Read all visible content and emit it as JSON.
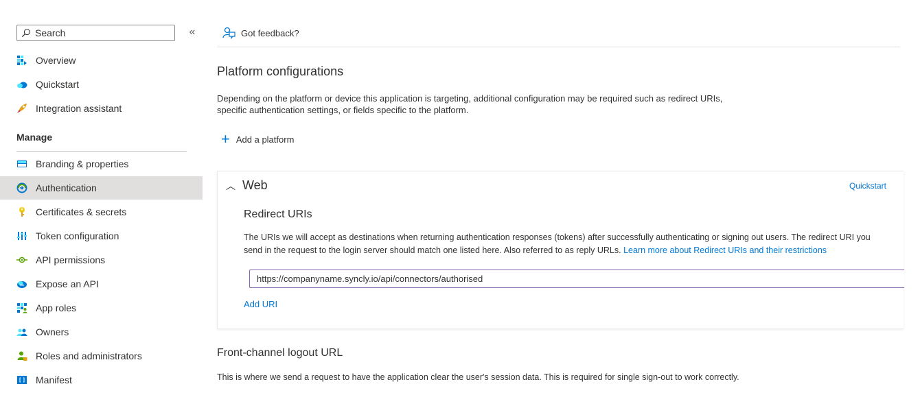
{
  "sidebar": {
    "search": {
      "placeholder": "Search",
      "value": ""
    },
    "collapse_glyph": "«",
    "section_label": "Manage",
    "items": [
      {
        "label": "Overview",
        "icon": "overview-icon",
        "color": "#0078d4"
      },
      {
        "label": "Quickstart",
        "icon": "quickstart-icon",
        "color": "#0078d4"
      },
      {
        "label": "Integration assistant",
        "icon": "rocket-icon",
        "color": "#e3a21a"
      },
      {
        "label": "Branding & properties",
        "icon": "branding-icon",
        "color": "#0078d4"
      },
      {
        "label": "Authentication",
        "icon": "authentication-icon",
        "color": "#0078d4",
        "active": true
      },
      {
        "label": "Certificates & secrets",
        "icon": "key-icon",
        "color": "#f2c811"
      },
      {
        "label": "Token configuration",
        "icon": "token-icon",
        "color": "#0078d4"
      },
      {
        "label": "API permissions",
        "icon": "api-permissions-icon",
        "color": "#57a300"
      },
      {
        "label": "Expose an API",
        "icon": "cloud-icon",
        "color": "#0078d4"
      },
      {
        "label": "App roles",
        "icon": "app-roles-icon",
        "color": "#0078d4"
      },
      {
        "label": "Owners",
        "icon": "owners-icon",
        "color": "#0078d4"
      },
      {
        "label": "Roles and administrators",
        "icon": "roles-admin-icon",
        "color": "#57a300"
      },
      {
        "label": "Manifest",
        "icon": "manifest-icon",
        "color": "#0078d4"
      }
    ]
  },
  "main": {
    "feedback_label": "Got feedback?",
    "platform_title": "Platform configurations",
    "platform_desc": "Depending on the platform or device this application is targeting, additional configuration may be required such as redirect URIs, specific authentication settings, or fields specific to the platform.",
    "add_platform_label": "Add a platform",
    "web": {
      "title": "Web",
      "quickstart_label": "Quickstart",
      "redirect_title": "Redirect URIs",
      "redirect_desc_line1": "The URIs we will accept as destinations when returning authentication responses (tokens) after successfully authenticating or signing out users. The redirect URI you",
      "redirect_desc_line2": "send in the request to the login server should match one listed here. Also referred to as reply URLs. ",
      "learn_more_label": "Learn more about Redirect URIs and their restrictions",
      "uri_value": "https://companyname.syncly.io/api/connectors/authorised",
      "add_uri_label": "Add URI"
    },
    "front_channel_title": "Front-channel logout URL",
    "front_channel_desc": "This is where we send a request to have the application clear the user's session data. This is required for single sign-out to work correctly."
  },
  "colors": {
    "accent": "#0078d4",
    "active_bg": "#e1dfdd",
    "focus_border": "#8764b8"
  }
}
